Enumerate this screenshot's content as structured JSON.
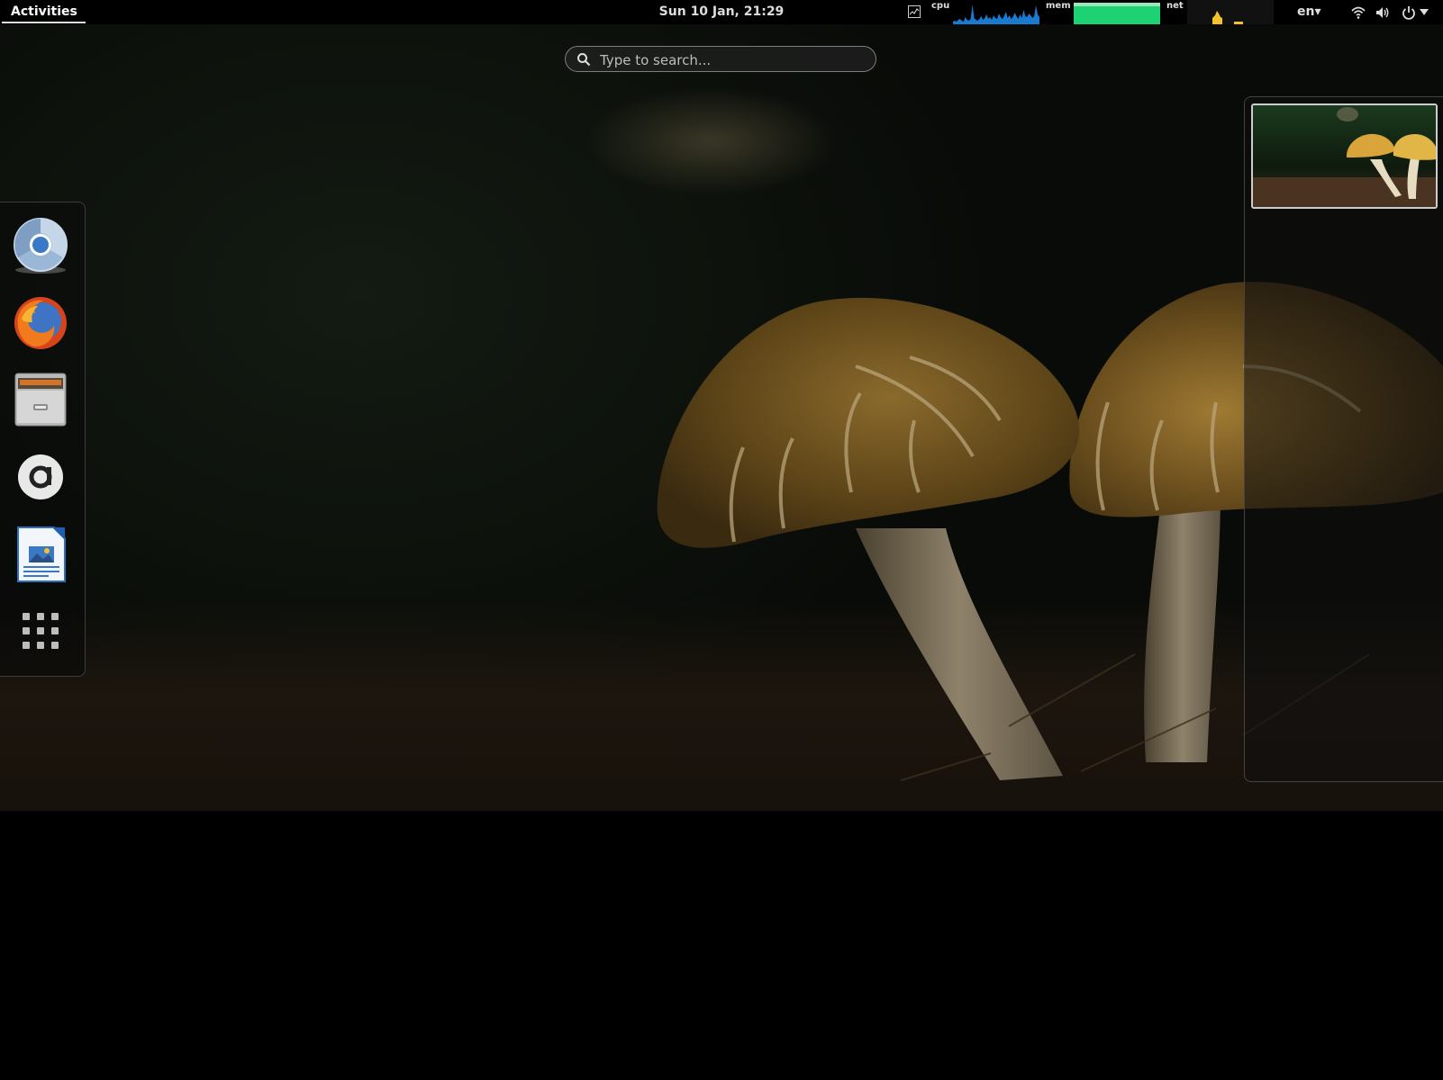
{
  "topbar": {
    "activities_label": "Activities",
    "clock": "Sun 10 Jan, 21:29",
    "system_monitor": {
      "cpu_label": "cpu",
      "mem_label": "mem",
      "net_label": "net",
      "cpu_color": "#1a7ad0",
      "mem_color": "#1ed173",
      "net_color": "#f2c12e"
    },
    "language": "en▾",
    "tray_icons": [
      "wifi-icon",
      "volume-icon",
      "power-icon",
      "chevron-down-icon"
    ]
  },
  "search": {
    "placeholder": "Type to search..."
  },
  "dash": {
    "items": [
      {
        "name": "chromium",
        "icon": "chromium-icon"
      },
      {
        "name": "firefox",
        "icon": "firefox-icon"
      },
      {
        "name": "files",
        "icon": "file-cabinet-icon"
      },
      {
        "name": "amazon",
        "icon": "amazon-icon"
      },
      {
        "name": "image-viewer",
        "icon": "document-image-icon"
      },
      {
        "name": "show-applications",
        "icon": "grid-icon"
      }
    ]
  },
  "workspaces": {
    "count": 1,
    "active": 1
  }
}
